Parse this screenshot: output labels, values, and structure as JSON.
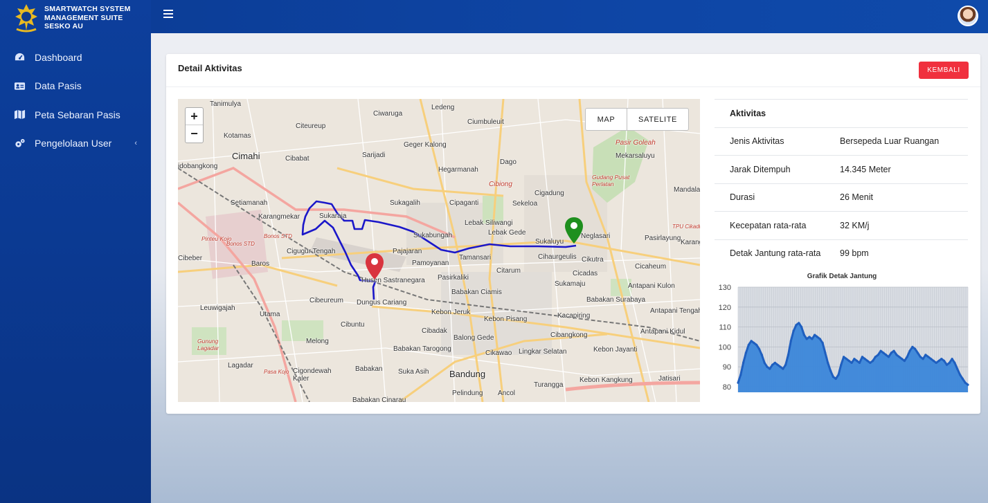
{
  "app": {
    "brand_lines": "SMARTWATCH SYSTEM\nMANAGEMENT SUITE\nSESKO AU"
  },
  "sidebar": {
    "items": [
      {
        "label": "Dashboard",
        "icon": "dashboard-gauge-icon"
      },
      {
        "label": "Data Pasis",
        "icon": "id-card-icon"
      },
      {
        "label": "Peta Sebaran Pasis",
        "icon": "map-icon"
      },
      {
        "label": "Pengelolaan User",
        "icon": "gears-icon",
        "chevron": "‹"
      }
    ]
  },
  "card": {
    "title": "Detail Aktivitas",
    "back_label": "KEMBALI"
  },
  "map": {
    "zoom_in": "+",
    "zoom_out": "−",
    "layer_map": "MAP",
    "layer_satellite": "SATELITE",
    "labels": [
      "Tanimulya",
      "Ciwaruga",
      "Ledeng",
      "Ciumbuleuit",
      "Kotamas",
      "Citeureup",
      "Cimahi",
      "Cibabat",
      "Sarijadi",
      "Geger Kalong",
      "Hegarmanah",
      "Dago",
      "Pasir Goleah",
      "Mekarsaluyu",
      "Gudang Pusat Perlatan",
      "idobangkong",
      "Cibiong",
      "Cigadung",
      "Mandala",
      "Setiamanah",
      "Karangmekar",
      "Sukaraja",
      "Sukagalih",
      "Cipaganti",
      "Sekeloa",
      "Lebak Siliwangi",
      "Lebak Gede",
      "Sukabungah",
      "Sukaluyu",
      "Neglasari",
      "Pasirlayung",
      "TPU Cikadut",
      "Karang",
      "Cibeber",
      "Cigugur Tengah",
      "Pajajaran",
      "Pamoyanan",
      "Tamansari",
      "Citarum",
      "Cihaurgeulis",
      "Cikutra",
      "Cicaheum",
      "Baros",
      "Husen Sastranegara",
      "Pasirkaliki",
      "Cicadas",
      "Sukamaju",
      "Antapani Kulon",
      "Cibeureum",
      "Dungus Cariang",
      "Babakan Ciamis",
      "Babakan Surabaya",
      "Leuwigajah",
      "Utama",
      "Kebon Jeruk",
      "Kebon Pisang",
      "Kacapiring",
      "Antapani Tengah",
      "Cibuntu",
      "Cibadak",
      "Balong Gede",
      "Cibangkong",
      "Antapani Kidul",
      "Gunung Lagadar",
      "Melong",
      "Babakan Tarogong",
      "Cikawao",
      "Lingkar Selatan",
      "Kebon Jayanti",
      "Lagadar",
      "Cigondewah Kaler",
      "Babakan",
      "Suka Asih",
      "Bandung",
      "Turangga",
      "Kebon Kangkung",
      "Jatisari",
      "Pelindung",
      "Ancol",
      "Babakan Cinarau",
      "Pinteu Kojo",
      "Bonos STD",
      "Bonos STD",
      "Pasa Kojo"
    ]
  },
  "activity": {
    "header": "Aktivitas",
    "rows": [
      {
        "key": "Jenis Aktivitas",
        "value": "Bersepeda Luar Ruangan"
      },
      {
        "key": "Jarak Ditempuh",
        "value": "14.345 Meter"
      },
      {
        "key": "Durasi",
        "value": "26 Menit"
      },
      {
        "key": "Kecepatan rata-rata",
        "value": "32 KM/j"
      },
      {
        "key": "Detak Jantung rata-rata",
        "value": "99 bpm"
      }
    ]
  },
  "colors": {
    "sidebar_bg": "#0d3f9c",
    "danger": "#f0303e",
    "route": "#1b17c9",
    "start_marker": "#d9343f",
    "end_marker": "#1e8f1e",
    "chart_fill": "#3b86d9",
    "chart_line": "#1f5fbf"
  },
  "chart_data": {
    "type": "area",
    "title": "Grafik Detak Jantung",
    "ylim": [
      80,
      130
    ],
    "yticks": [
      80,
      90,
      100,
      110,
      120,
      130
    ],
    "grid": true,
    "values": [
      82,
      86,
      92,
      97,
      101,
      103,
      102,
      101,
      99,
      96,
      92,
      90,
      89,
      91,
      92,
      91,
      90,
      89,
      91,
      96,
      103,
      108,
      111,
      112,
      110,
      106,
      104,
      105,
      104,
      106,
      105,
      104,
      102,
      97,
      92,
      88,
      85,
      84,
      86,
      91,
      95,
      94,
      93,
      92,
      94,
      93,
      92,
      95,
      94,
      93,
      92,
      93,
      95,
      96,
      98,
      97,
      96,
      95,
      97,
      98,
      96,
      95,
      94,
      93,
      95,
      98,
      100,
      99,
      97,
      95,
      94,
      96,
      95,
      94,
      93,
      92,
      93,
      94,
      93,
      91,
      92,
      94,
      92,
      89,
      86,
      84,
      82,
      81
    ]
  }
}
